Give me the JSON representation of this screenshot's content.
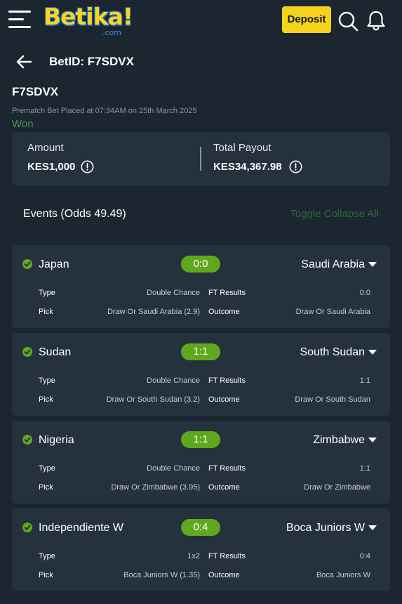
{
  "header": {
    "logo_text": "Betika!",
    "logo_sub": ".com",
    "deposit_label": "Deposit"
  },
  "page": {
    "title": "BetID:  F7SDVX",
    "bet_code": "F7SDVX",
    "placed_text": "Prematch Bet Placed at 07:34AM on 25th March 2025",
    "status": "Won"
  },
  "summary": {
    "amount_label": "Amount",
    "amount_value": "KES1,000",
    "payout_label": "Total Payout",
    "payout_value": "KES34,367.98"
  },
  "events_header": {
    "label": "Events (Odds 49.49)",
    "toggle_label": "Toggle Collapse All"
  },
  "events": [
    {
      "home": "Japan",
      "away": "Saudi Arabia",
      "score": "0:0",
      "type_label": "Type",
      "type_value": "Double Chance",
      "ft_label": "FT Results",
      "ft_value": "0:0",
      "pick_label": "Pick",
      "pick_value": "Draw Or Saudi Arabia (2.9)",
      "outcome_label": "Outcome",
      "outcome_value": "Draw Or Saudi Arabia"
    },
    {
      "home": "Sudan",
      "away": "South Sudan",
      "score": "1:1",
      "type_label": "Type",
      "type_value": "Double Chance",
      "ft_label": "FT Results",
      "ft_value": "1:1",
      "pick_label": "Pick",
      "pick_value": "Draw Or South Sudan (3.2)",
      "outcome_label": "Outcome",
      "outcome_value": "Draw Or South Sudan"
    },
    {
      "home": "Nigeria",
      "away": "Zimbabwe",
      "score": "1:1",
      "type_label": "Type",
      "type_value": "Double Chance",
      "ft_label": "FT Results",
      "ft_value": "1:1",
      "pick_label": "Pick",
      "pick_value": "Draw Or Zimbabwe (3.95)",
      "outcome_label": "Outcome",
      "outcome_value": "Draw Or Zimbabwe"
    },
    {
      "home": "Independiente W",
      "away": "Boca Juniors W",
      "score": "0:4",
      "type_label": "Type",
      "type_value": "1x2",
      "ft_label": "FT Results",
      "ft_value": "0:4",
      "pick_label": "Pick",
      "pick_value": "Boca Juniors W (1.35)",
      "outcome_label": "Outcome",
      "outcome_value": "Boca Juniors W"
    }
  ],
  "colors": {
    "background": "#1b2631",
    "card": "#25313d",
    "accent_yellow": "#f5d31d",
    "won_green": "#43a047",
    "score_green": "#5fa81e"
  },
  "icons": [
    "menu-icon",
    "search-icon",
    "bell-icon",
    "back-icon",
    "info-icon",
    "check-circle-icon",
    "caret-down-icon"
  ]
}
